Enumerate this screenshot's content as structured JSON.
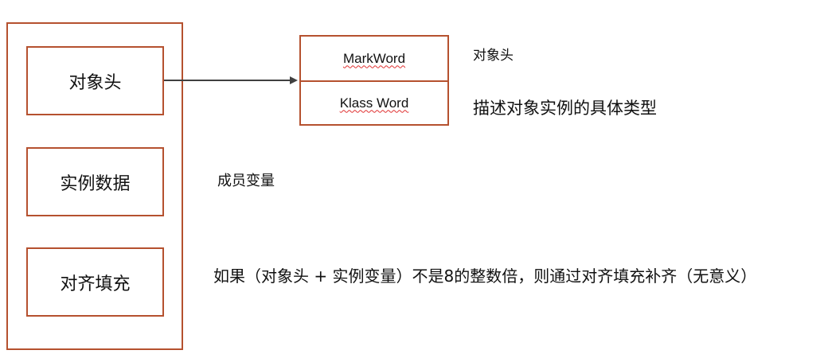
{
  "object_layout": {
    "parts": [
      {
        "label": "对象头"
      },
      {
        "label": "实例数据"
      },
      {
        "label": "对齐填充"
      }
    ]
  },
  "object_header": {
    "rows": [
      {
        "label": "MarkWord"
      },
      {
        "label": "Klass Word"
      }
    ]
  },
  "annotations": {
    "header_note": "对象头",
    "klass_note": "描述对象实例的具体类型",
    "instance_note": "成员变量",
    "padding_note": "如果（对象头 + 实例变量）不是8的整数倍，则通过对齐填充补齐（无意义）"
  },
  "colors": {
    "box_border": "#b5512f",
    "arrow": "#404040",
    "spellcheck_underline": "#e03030"
  }
}
